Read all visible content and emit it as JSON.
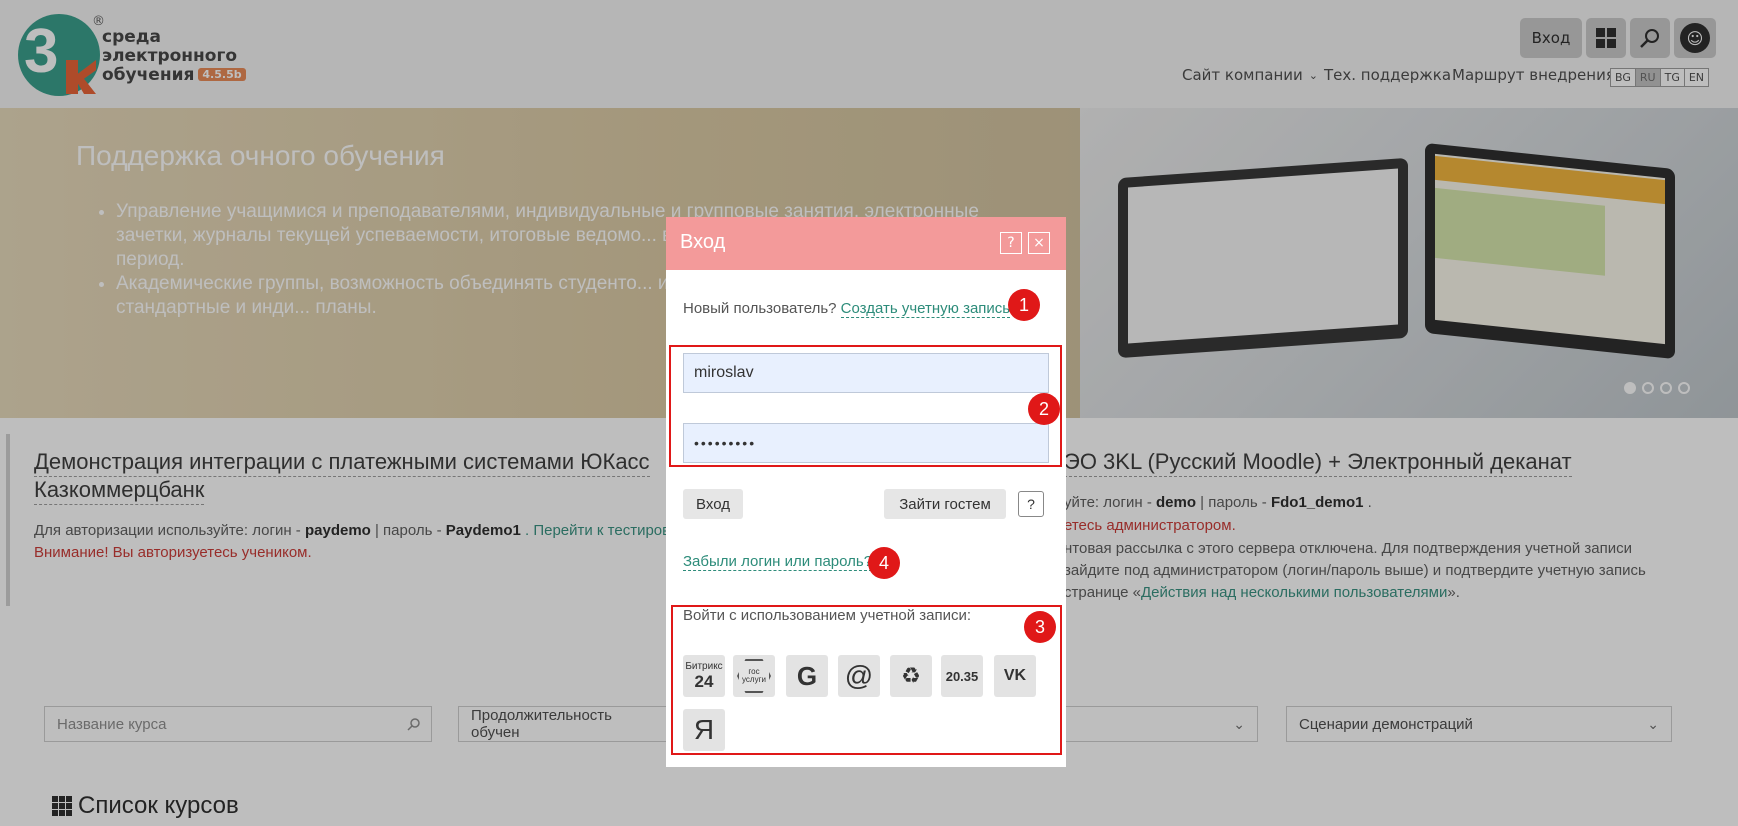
{
  "header": {
    "logo_lines": [
      "среда",
      "электронного",
      "обучения"
    ],
    "logo_version": "4.5.5b",
    "logo_reg": "®",
    "login_label": "Вход",
    "nav": {
      "company": "Сайт компании",
      "support": "Тех. поддержка",
      "route": "Маршрут внедрения"
    },
    "languages": [
      "BG",
      "RU",
      "TG",
      "EN"
    ],
    "active_language": "RU"
  },
  "hero": {
    "title": "Поддержка очного обучения",
    "bullets": [
      "Управление учащимися и преподавателями, индивидуальные и групповые занятия, электронные зачетки, журналы текущей успеваемости, итоговые ведомо... ведомость фактической нагрузки за период.",
      "Академические группы, возможность объединять студенто... индивидуальные учебные траектории, стандартные и инди... планы."
    ],
    "slides": 4,
    "active_slide": 1
  },
  "cards": {
    "left_title_1": "Демонстрация интеграции с платежными системами ЮКасс",
    "left_title_2": "Казкоммерцбанк",
    "left_info_pre": "Для авторизации используйте: логин - ",
    "left_login": "paydemo",
    "left_info_mid": " | пароль - ",
    "left_pass": "Paydemo1",
    "left_link": " . Перейти к тестиров",
    "left_warn": "Внимание! Вы авторизуетесь учеником.",
    "right_title": "ЭО 3KL (Русский Moodle) + Электронный деканат",
    "right_info_pre": "уйте: логин - ",
    "right_login": "demo",
    "right_info_mid": " | пароль - ",
    "right_pass": "Fdo1_demo1",
    "right_info_end": " .",
    "right_warn": "етесь администратором.",
    "right_l1": "нтовая рассылка с этого сервера отключена. Для подтверждения учетной записи",
    "right_l2": "зайдите под администратором (логин/пароль выше) и подтвердите учетную запись",
    "right_l3_pre": "странице «",
    "right_l3_link": "Действия над несколькими пользователями",
    "right_l3_end": "»."
  },
  "filters": {
    "course_name_placeholder": "Название курса",
    "duration": "Продолжительность обучен",
    "scenarios": "Сценарии демонстраций"
  },
  "courses_heading": "Список курсов",
  "modal": {
    "title": "Вход",
    "help": "?",
    "close": "×",
    "new_user_label": "Новый пользователь?",
    "create_account": "Создать учетную запись",
    "username": "miroslav",
    "password_mask": "•••••••••",
    "enter_button": "Вход",
    "guest_button": "Зайти гостем",
    "guest_help": "?",
    "forgot": "Забыли логин или пароль?",
    "social_label": "Войти с использованием учетной записи:",
    "social": {
      "bitrix_top": "Битрикс",
      "bitrix_bottom": "24",
      "gosuslugi": "гос услуги",
      "google": "G",
      "mail": "@",
      "recycle": "♻",
      "u2035": "20.35",
      "vk": "VK",
      "yandex": "Я"
    },
    "badges": [
      "1",
      "2",
      "3",
      "4"
    ]
  },
  "colors": {
    "modal_header": "#f39a9a",
    "annotation_red": "#e01818",
    "link_teal": "#2d8c7a"
  }
}
